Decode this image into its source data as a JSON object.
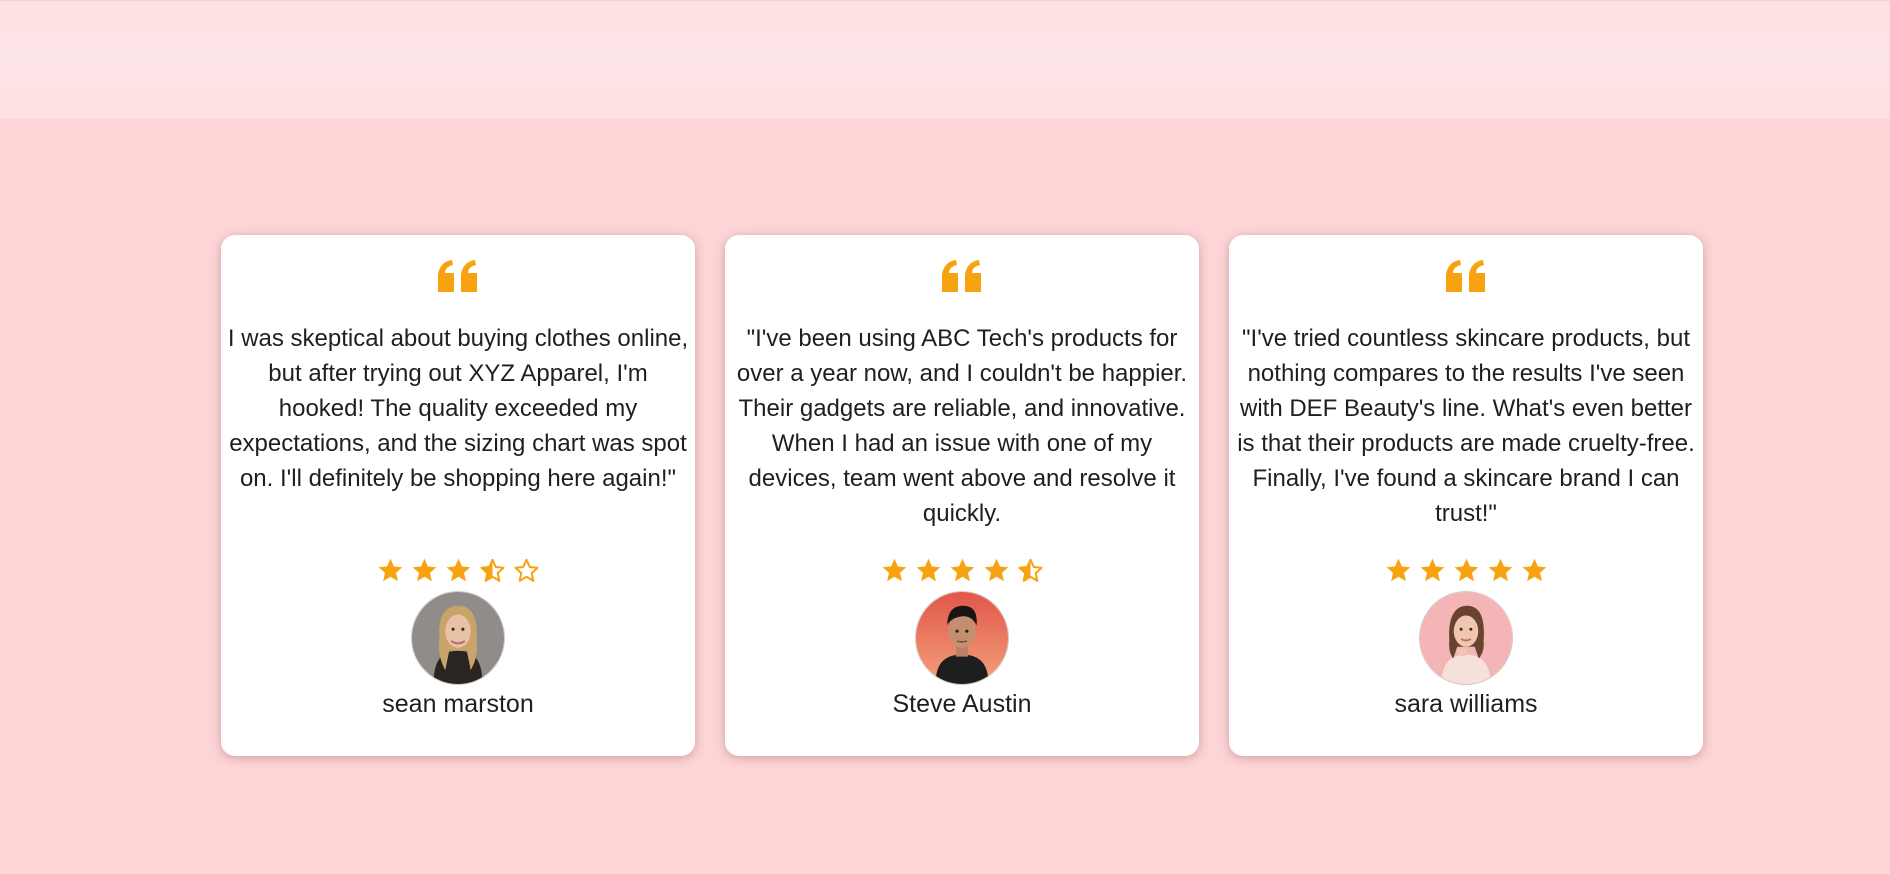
{
  "colors": {
    "background": "#fdd5d6",
    "card": "#ffffff",
    "accent": "#f7a211",
    "text": "#1f1f1f"
  },
  "testimonials": [
    {
      "quote": "I was skeptical about buying clothes online, but after trying out XYZ Apparel, I'm hooked! The quality exceeded my expectations, and the sizing chart was spot on. I'll definitely be shopping here again!\"",
      "rating": 3.5,
      "stars": [
        "star-full-icon",
        "star-full-icon",
        "star-full-icon",
        "star-half-icon",
        "star-empty-icon"
      ],
      "name": "sean marston",
      "avatar": "avatar-woman-blonde"
    },
    {
      "quote": "\"I've been using ABC Tech's products for over a year now, and I couldn't be happier. Their gadgets are reliable, and innovative. When I had an issue with one of my devices, team went above and resolve it quickly.",
      "rating": 4.5,
      "stars": [
        "star-full-icon",
        "star-full-icon",
        "star-full-icon",
        "star-full-icon",
        "star-half-icon"
      ],
      "name": "Steve Austin",
      "avatar": "avatar-man-dark-hair"
    },
    {
      "quote": "\"I've tried countless skincare products, but nothing compares to the results I've seen with DEF Beauty's line. What's even better is that their products are made cruelty-free. Finally, I've found a skincare brand I can trust!\"",
      "rating": 5,
      "stars": [
        "star-full-icon",
        "star-full-icon",
        "star-full-icon",
        "star-full-icon",
        "star-full-icon"
      ],
      "name": "sara williams",
      "avatar": "avatar-woman-brunette"
    }
  ]
}
